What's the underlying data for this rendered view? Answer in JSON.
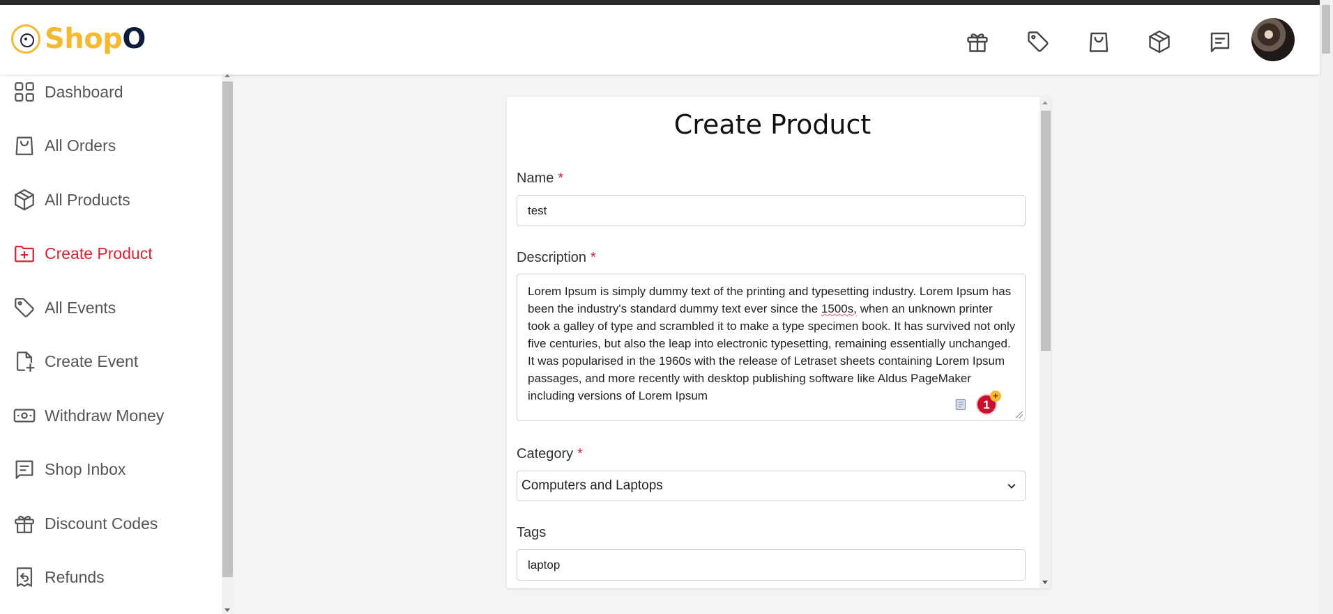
{
  "brand": {
    "logo_part1": "Shop",
    "logo_part2": "O"
  },
  "header": {
    "icons": [
      "gift-icon",
      "tag-icon",
      "shopping-bag-icon",
      "package-icon",
      "message-icon"
    ]
  },
  "sidebar": {
    "items": [
      {
        "label": "Dashboard",
        "icon": "dashboard-grid-icon",
        "active": false
      },
      {
        "label": "All Orders",
        "icon": "shopping-bag-icon",
        "active": false
      },
      {
        "label": "All Products",
        "icon": "package-icon",
        "active": false
      },
      {
        "label": "Create Product",
        "icon": "folder-plus-icon",
        "active": true
      },
      {
        "label": "All Events",
        "icon": "tag-icon",
        "active": false
      },
      {
        "label": "Create Event",
        "icon": "file-plus-icon",
        "active": false
      },
      {
        "label": "Withdraw Money",
        "icon": "cash-icon",
        "active": false
      },
      {
        "label": "Shop Inbox",
        "icon": "message-icon",
        "active": false
      },
      {
        "label": "Discount Codes",
        "icon": "gift-icon",
        "active": false
      },
      {
        "label": "Refunds",
        "icon": "receipt-refund-icon",
        "active": false
      }
    ]
  },
  "form": {
    "title": "Create Product",
    "required_mark": "*",
    "name": {
      "label": "Name",
      "value": "test"
    },
    "description": {
      "label": "Description",
      "text_before": "Lorem Ipsum is simply dummy text of the printing and typesetting industry. Lorem Ipsum has been the industry's standard dummy text ever since the ",
      "misspelled": "1500s,",
      "text_after": " when an unknown printer took a galley of type and scrambled it to make a type specimen book. It has survived not only five centuries, but also the leap into electronic typesetting, remaining essentially unchanged. It was popularised in the 1960s with the release of Letraset sheets containing Lorem Ipsum passages, and more recently with desktop publishing software like Aldus PageMaker including versions of Lorem Ipsum",
      "grammar_badge_count": "1",
      "grammar_badge_plus": "+"
    },
    "category": {
      "label": "Category",
      "selected": "Computers and Laptops"
    },
    "tags": {
      "label": "Tags",
      "value": "laptop"
    }
  },
  "colors": {
    "accent": "#dd1f35",
    "logo_yellow": "#f5b82e",
    "logo_navy": "#0d1b3a"
  }
}
